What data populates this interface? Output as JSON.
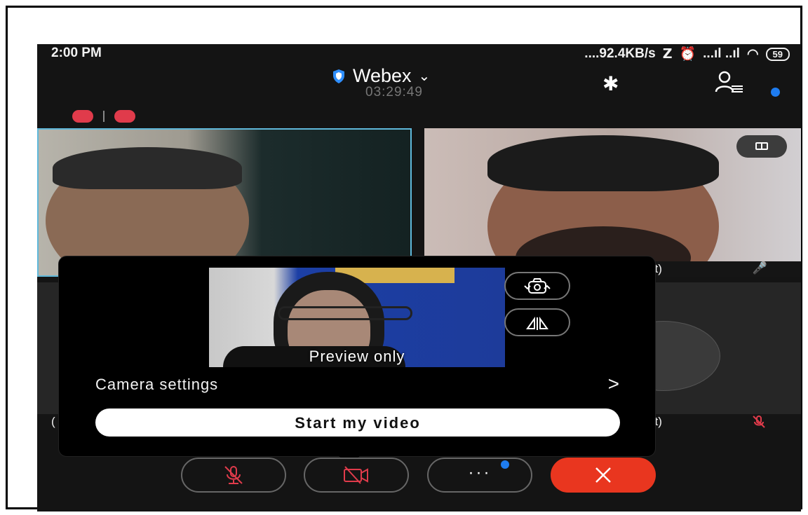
{
  "status_bar": {
    "time": "2:00 PM",
    "network_speed": "....92.4KB/s",
    "signal_text": "...ıl ..ıl",
    "battery": "59"
  },
  "header": {
    "app_name": "Webex",
    "call_timer": "03:29:49"
  },
  "participants": {
    "tile2_name_partial": "st)",
    "tile4_name_partial": "st)",
    "tile3_name_partial": "("
  },
  "camera_popup": {
    "preview_label": "Preview only",
    "camera_settings_label": "Camera settings",
    "camera_settings_chevron": ">",
    "start_video_label": "Start my video",
    "switch_camera_icon": "camera-switch-icon",
    "mirror_icon": "mirror-flip-icon"
  },
  "controls": {
    "more_label": "···"
  },
  "colors": {
    "accent_blue": "#1e7cf0",
    "end_call_red": "#e9361f",
    "mute_red": "#e03b4b",
    "active_tile_border": "#5fb8da"
  }
}
